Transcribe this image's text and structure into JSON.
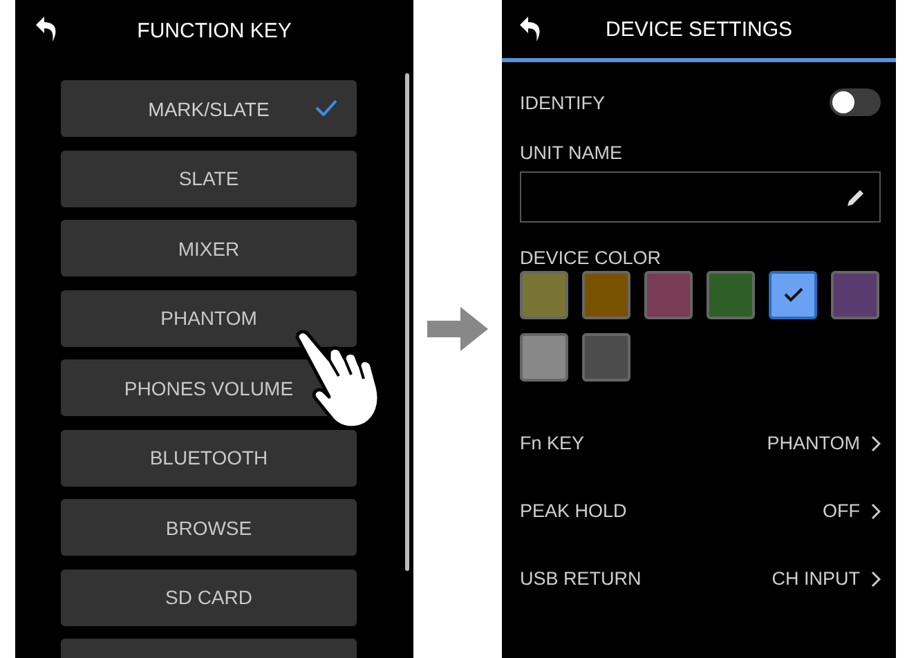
{
  "function_key": {
    "title": "FUNCTION KEY",
    "options": [
      {
        "label": "MARK/SLATE",
        "selected": true
      },
      {
        "label": "SLATE",
        "selected": false
      },
      {
        "label": "MIXER",
        "selected": false
      },
      {
        "label": "PHANTOM",
        "selected": false
      },
      {
        "label": "PHONES VOLUME",
        "selected": false
      },
      {
        "label": "BLUETOOTH",
        "selected": false
      },
      {
        "label": "BROWSE",
        "selected": false
      },
      {
        "label": "SD CARD",
        "selected": false
      }
    ]
  },
  "device_settings": {
    "title": "DEVICE SETTINGS",
    "identify": {
      "label": "IDENTIFY",
      "on": false
    },
    "unit_name": {
      "label": "UNIT NAME"
    },
    "device_color": {
      "label": "DEVICE COLOR",
      "swatches": [
        {
          "color": "#797434",
          "selected": false
        },
        {
          "color": "#795200",
          "selected": false
        },
        {
          "color": "#7a3b56",
          "selected": false
        },
        {
          "color": "#2e5f27",
          "selected": false
        },
        {
          "color": "#6aa1f2",
          "selected": true
        },
        {
          "color": "#5a3b6d",
          "selected": false
        },
        {
          "color": "#888888",
          "selected": false
        },
        {
          "color": "#4c4c4c",
          "selected": false
        }
      ]
    },
    "settings": [
      {
        "label": "Fn KEY",
        "value": "PHANTOM"
      },
      {
        "label": "PEAK HOLD",
        "value": "OFF"
      },
      {
        "label": "USB RETURN",
        "value": "CH INPUT"
      }
    ]
  }
}
